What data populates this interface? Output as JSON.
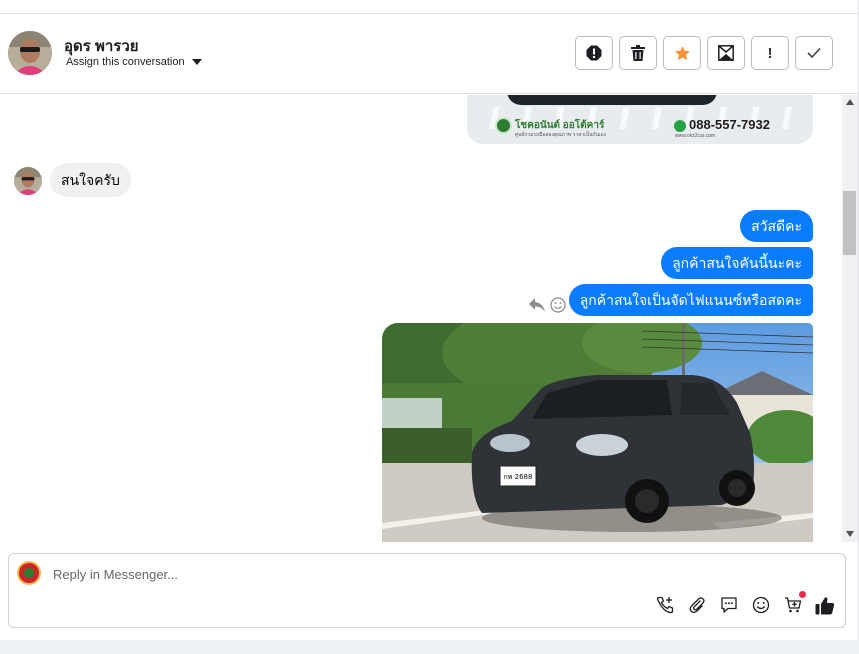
{
  "header": {
    "contact_name": "อุดร พารวย",
    "assign_label": "Assign this conversation"
  },
  "toolbar": {
    "actions": [
      "spam-icon",
      "trash-icon",
      "star-icon",
      "mark-unread-icon",
      "follow-up-icon",
      "done-check-icon"
    ],
    "follow_up_glyph": "!"
  },
  "banner": {
    "brand": "โชคอนันต์ ออโต้คาร์",
    "brand_sub": "ศูนย์รวมรถมือสองคุณภาพ ราคาเป็นกันเอง",
    "phone": "088-557-7932",
    "website": "www.okz2car.com"
  },
  "messages": {
    "incoming_1": "สนใจครับ",
    "outgoing_1": "สวัสดีคะ",
    "outgoing_2": "ลูกค้าสนใจคันนี้นะคะ",
    "outgoing_3": "ลูกค้าสนใจเป็นจัดไฟแนนซ์หรือสดคะ"
  },
  "photo": {
    "plate": "กพ 2688"
  },
  "composer": {
    "placeholder": "Reply in Messenger...",
    "tools": [
      "add-call-icon",
      "attachment-icon",
      "saved-reply-icon",
      "emoji-icon",
      "cart-icon",
      "thumbs-up-icon"
    ]
  },
  "colors": {
    "outgoing_bubble": "#0a7cff",
    "incoming_bubble": "#f0f0f0",
    "star": "#f7923a",
    "cart_dot": "#f02849"
  }
}
